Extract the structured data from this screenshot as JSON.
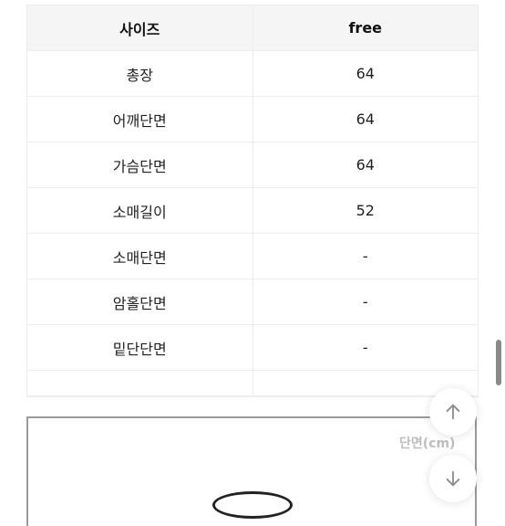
{
  "size_table": {
    "header": {
      "label": "사이즈",
      "value": "free"
    },
    "rows": [
      {
        "label": "총장",
        "value": "64"
      },
      {
        "label": "어깨단면",
        "value": "64"
      },
      {
        "label": "가슴단면",
        "value": "64"
      },
      {
        "label": "소매길이",
        "value": "52"
      },
      {
        "label": "소매단면",
        "value": "-"
      },
      {
        "label": "암홀단면",
        "value": "-"
      },
      {
        "label": "밑단단면",
        "value": "-"
      }
    ]
  },
  "diagram": {
    "unit_label": "단면(cm)"
  },
  "controls": {
    "scroll_up_icon": "arrow-up-icon",
    "scroll_down_icon": "arrow-down-icon"
  }
}
